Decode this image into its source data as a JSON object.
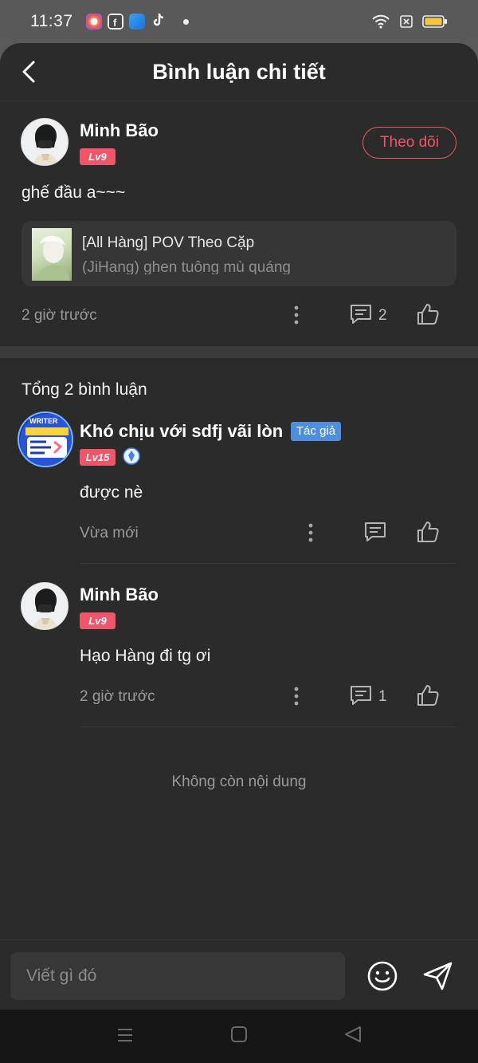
{
  "status_bar": {
    "time": "11:37"
  },
  "header": {
    "title": "Bình luận chi tiết"
  },
  "post": {
    "author": "Minh Bão",
    "level": "Lv9",
    "follow_label": "Theo dõi",
    "text": "ghế đầu a~~~",
    "story": {
      "title": "[All Hàng] POV Theo Cặp",
      "subtitle": "(JiHang) ghen tuông mù quáng"
    },
    "time": "2 giờ trước",
    "reply_count": "2"
  },
  "comments_section": {
    "total_label": "Tổng 2 bình luận",
    "comments": [
      {
        "author": "Khó chịu với sdfj vãi lòn",
        "author_tag": "Tác giả",
        "level": "Lv15",
        "avatar_text": "WRITER",
        "text": "được nè",
        "time": "Vừa mới",
        "reply_count": ""
      },
      {
        "author": "Minh Bão",
        "level": "Lv9",
        "text": "Hạo Hàng đi tg ơi",
        "time": "2 giờ trước",
        "reply_count": "1"
      }
    ],
    "end_label": "Không còn nội dung"
  },
  "composer": {
    "placeholder": "Viết gì đó"
  },
  "icons": {
    "back": "chevron-left-icon",
    "more": "more-vertical-icon",
    "reply": "comment-icon",
    "like": "thumbs-up-icon",
    "emoji": "smile-icon",
    "send": "send-icon"
  },
  "colors": {
    "background": "#2b2b2b",
    "accent": "#f0556a",
    "author_tag": "#4d8fde",
    "card": "#363636"
  }
}
